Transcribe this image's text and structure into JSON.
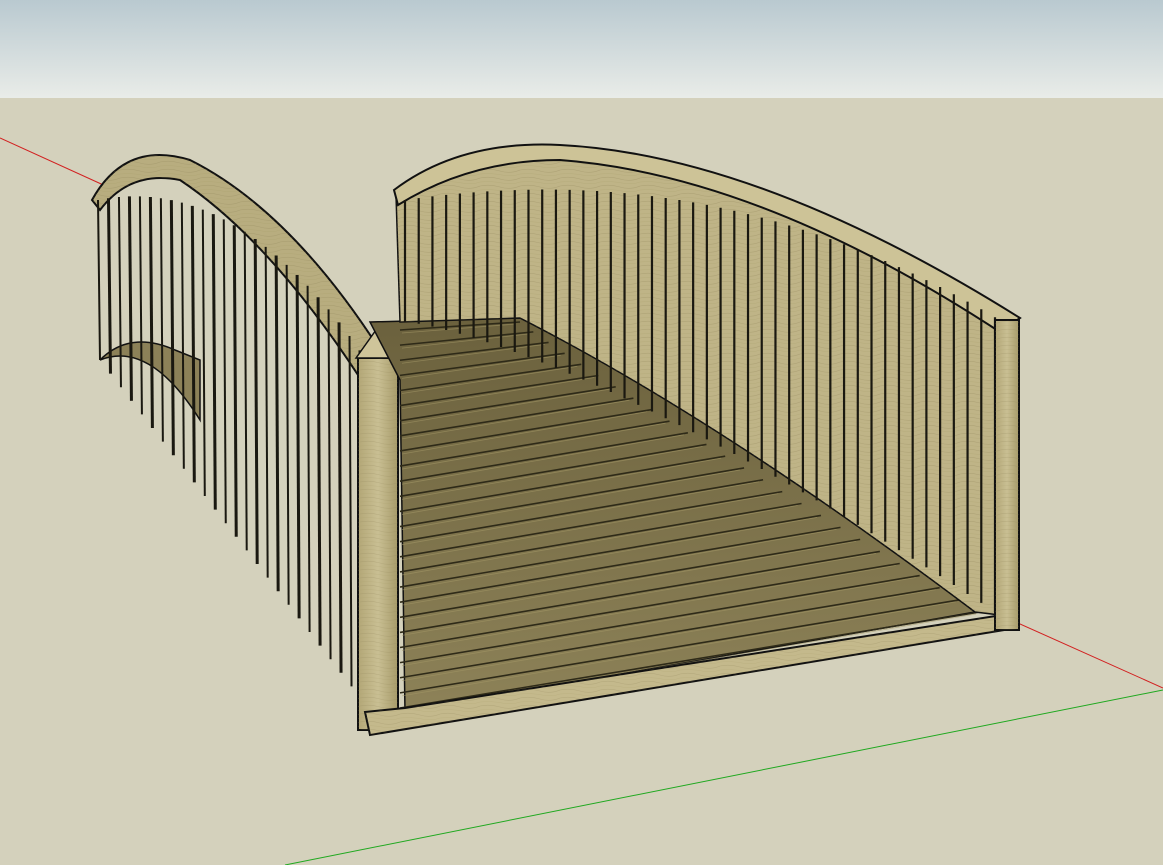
{
  "scene": {
    "subject": "wooden-arched-footbridge",
    "style": "sketchup-3d-model-viewport",
    "colors": {
      "sky_top": "#b9c9d0",
      "sky_bottom": "#e9ece8",
      "ground": "#d4d1bc",
      "wood_light": "#c4b98c",
      "wood_mid": "#9a8e62",
      "wood_dark": "#6b613d",
      "plank_shadow": "#3a3420",
      "edge": "#111111",
      "red_axis": "#d22020",
      "green_axis": "#1fa81f"
    },
    "axes": [
      "red-axis",
      "green-axis"
    ]
  }
}
